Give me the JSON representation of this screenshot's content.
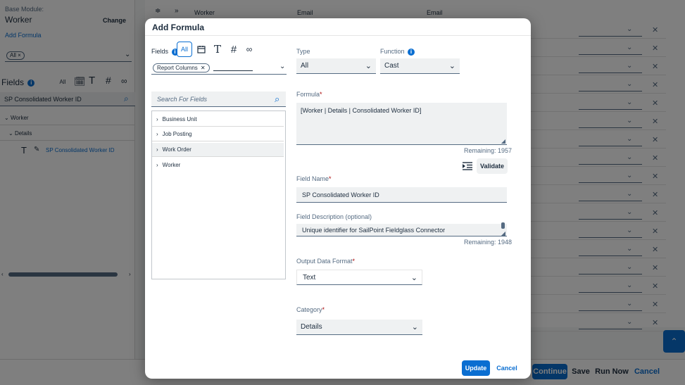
{
  "background": {
    "base_module_label": "Base Module:",
    "base_module_value": "Worker",
    "change_label": "Change",
    "add_formula_link": "Add Formula",
    "filter_token": "All",
    "fields_label": "Fields",
    "field_type_all": "All",
    "search_value": "SP Consolidated Worker ID",
    "tree": [
      {
        "label": "Worker"
      },
      {
        "label": "Details"
      },
      {
        "label": "SP Consolidated Worker ID"
      }
    ],
    "grid_headers": [
      "Worker",
      "Email",
      "Email"
    ],
    "footer_buttons": {
      "continue": "Continue",
      "save": "Save",
      "run_now": "Run Now",
      "cancel": "Cancel"
    }
  },
  "dialog": {
    "title": "Add Formula",
    "fields_label": "Fields",
    "field_types": {
      "all": "All"
    },
    "columns_token": "Report Columns",
    "search_placeholder": "Search For Fields",
    "tree": [
      "Business Unit",
      "Job Posting",
      "Work Order",
      "Worker"
    ],
    "type_label": "Type",
    "type_value": "All",
    "function_label": "Function",
    "function_value": "Cast",
    "formula_label": "Formula",
    "formula_value": "[Worker | Details | Consolidated Worker ID]",
    "formula_remaining": "Remaining: 1957",
    "validate_label": "Validate",
    "field_name_label": "Field Name",
    "field_name_value": "SP Consolidated Worker ID",
    "field_desc_label": "Field Description (optional)",
    "field_desc_value": "Unique identifier for SailPoint Fieldglass Connector",
    "desc_remaining": "Remaining: 1948",
    "output_format_label": "Output Data Format",
    "output_format_value": "Text",
    "category_label": "Category",
    "category_value": "Details",
    "update_label": "Update",
    "cancel_label": "Cancel"
  },
  "colors": {
    "accent": "#0a6ed1",
    "required": "#aa0808",
    "text": "#1d2d3e"
  }
}
